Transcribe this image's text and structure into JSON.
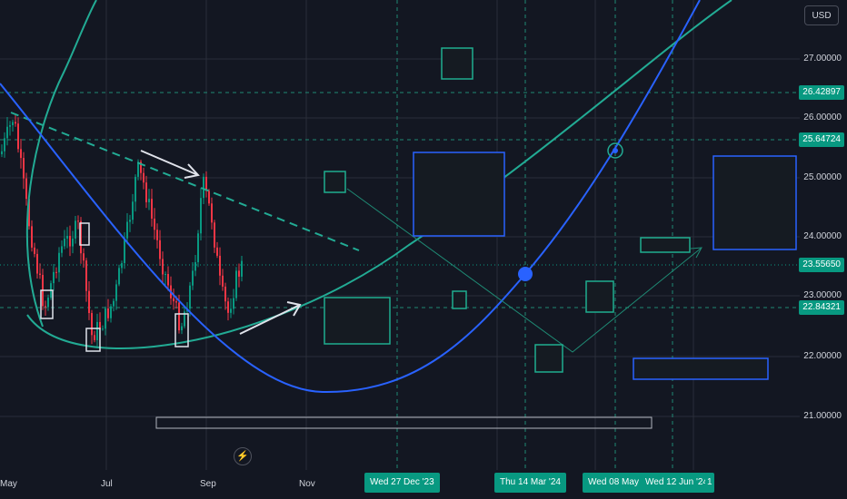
{
  "axis": {
    "currency": "USD",
    "y_ticks": [
      "27.00000",
      "26.00000",
      "25.00000",
      "24.00000",
      "23.00000",
      "22.00000",
      "21.00000"
    ],
    "price_tags": [
      "26.42897",
      "25.64724",
      "23.55650",
      "22.84321"
    ],
    "x_ticks": [
      "May",
      "Jul",
      "Sep",
      "Nov"
    ],
    "date_tags": [
      "Wed 27 Dec '23",
      "Thu 14 Mar '24",
      "Wed 08 May '2",
      "Wed 12 Jun '24",
      "1"
    ]
  },
  "chart_data": {
    "type": "candlestick",
    "ylim": [
      20.5,
      28.0
    ],
    "price_levels": [
      26.42897,
      25.64724,
      23.5565,
      22.84321
    ],
    "up_color": "#089981",
    "down_color": "#f23645",
    "curve_colors": {
      "green": "#089981",
      "blue": "#2962ff"
    }
  },
  "bolt_icon": "lightning-bolt-icon"
}
